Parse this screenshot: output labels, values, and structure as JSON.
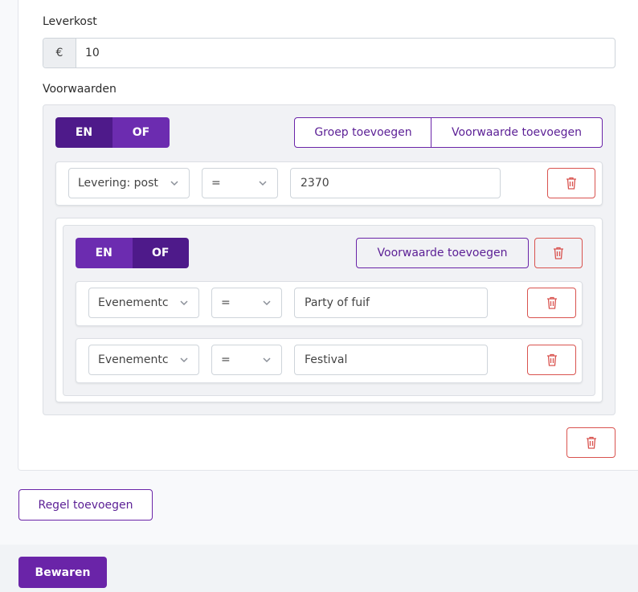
{
  "delivery_cost": {
    "label": "Leverkost",
    "prefix": "€",
    "value": "10"
  },
  "conditions": {
    "label": "Voorwaarden",
    "root_group": {
      "toggle": {
        "and_label": "EN",
        "or_label": "OF",
        "active": "EN"
      },
      "add_group_label": "Groep toevoegen",
      "add_condition_label": "Voorwaarde toevoegen",
      "rows": [
        {
          "field": "Levering: post",
          "operator": "=",
          "value": "2370"
        }
      ],
      "nested_group": {
        "toggle": {
          "and_label": "EN",
          "or_label": "OF",
          "active": "OF"
        },
        "add_condition_label": "Voorwaarde toevoegen",
        "rows": [
          {
            "field": "Evenementc",
            "operator": "=",
            "value": "Party of fuif"
          },
          {
            "field": "Evenementc",
            "operator": "=",
            "value": "Festival"
          }
        ]
      }
    }
  },
  "add_rule_label": "Regel toevoegen",
  "save_label": "Bewaren",
  "colors": {
    "primary": "#6a24a8",
    "primary_dark": "#4e1a8a",
    "danger": "#d9534f"
  }
}
